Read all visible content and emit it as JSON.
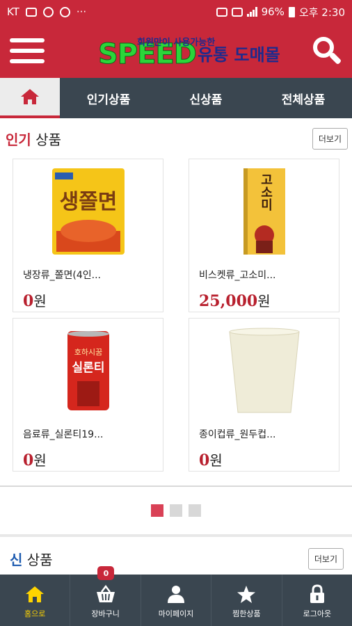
{
  "status_bar": {
    "carrier": "KT",
    "battery": "96%",
    "time": "오후 2:30",
    "more": "···"
  },
  "header": {
    "logo_sub": "회원만이 사용가능한",
    "logo_main": "SPEED",
    "logo_kr": "유통 도매몰"
  },
  "tabs": [
    {
      "label": "인기상품"
    },
    {
      "label": "신상품"
    },
    {
      "label": "전체상품"
    }
  ],
  "popular": {
    "title_accent": "인기",
    "title_rest": " 상품",
    "more_label": "더보기",
    "products": [
      {
        "name": "냉장류_쫄면(4인...",
        "price": "0",
        "unit": "원"
      },
      {
        "name": "비스켓류_고소미...",
        "price": "25,000",
        "unit": "원"
      },
      {
        "name": "음료류_실론티19...",
        "price": "0",
        "unit": "원"
      },
      {
        "name": "종이컵류_원두컵...",
        "price": "0",
        "unit": "원"
      }
    ],
    "thumb_texts": {
      "p1_main": "생쫄면",
      "p2_main": "고소미",
      "p3_top": "호하시꿈",
      "p3_main": "실론티"
    }
  },
  "pager": {
    "active": 1,
    "total": 3
  },
  "new": {
    "title_accent": "신",
    "title_rest": " 상품",
    "more_label": "더보기"
  },
  "bottom_nav": [
    {
      "label": "홈으로",
      "icon": "home-icon"
    },
    {
      "label": "장바구니",
      "icon": "basket-icon",
      "badge": "0"
    },
    {
      "label": "마이페이지",
      "icon": "person-icon"
    },
    {
      "label": "찜한상품",
      "icon": "star-icon"
    },
    {
      "label": "로그아웃",
      "icon": "lock-icon"
    }
  ],
  "colors": {
    "brand_red": "#c8283a",
    "nav_dark": "#3a4650",
    "price_red": "#b8202e",
    "active_yellow": "#ffd400"
  }
}
